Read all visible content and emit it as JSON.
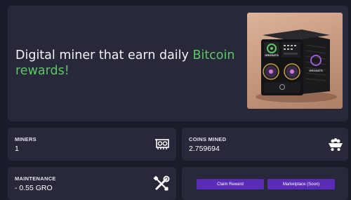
{
  "hero": {
    "text_prefix": "Digital miner that earn daily ",
    "text_accent": "Bitcoin rewards!",
    "image_brand": "GROSATS",
    "image_alt": "GROSATS digital miner device"
  },
  "stats": {
    "miners": {
      "label": "MINERS",
      "value": "1",
      "icon": "gpu-card-icon"
    },
    "coins_mined": {
      "label": "COINS MINED",
      "value": "2.759694",
      "icon": "mine-cart-icon"
    },
    "maintenance": {
      "label": "MAINTENANCE",
      "value": "- 0.55 GRO",
      "icon": "tools-icon"
    }
  },
  "actions": {
    "claim_label": "Claim Reward",
    "marketplace_label": "Marketplace (Soon)"
  },
  "colors": {
    "background": "#1b1c2a",
    "card": "#272839",
    "accent_green": "#5fc566",
    "button_purple": "#5a2bb4"
  }
}
